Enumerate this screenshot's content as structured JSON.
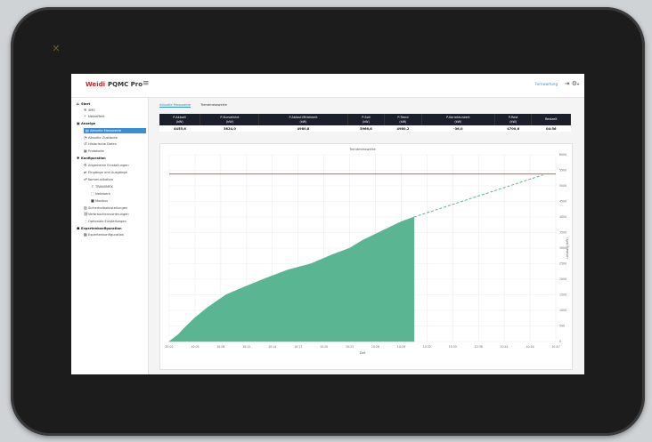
{
  "app": {
    "brand": "Weidi",
    "product": "PQMC Pro"
  },
  "topbar": {
    "user": "Fernwartung"
  },
  "sidebar": {
    "items": [
      {
        "label": "Start",
        "type": "head",
        "icon": "home-icon"
      },
      {
        "label": "SMS",
        "type": "sub",
        "icon": "sms-icon"
      },
      {
        "label": "Netzeffekt",
        "type": "sub",
        "icon": "network-icon"
      },
      {
        "label": "Anzeige",
        "type": "head",
        "icon": "display-icon"
      },
      {
        "label": "Aktuelle Messwerte",
        "type": "active",
        "icon": "chart-icon"
      },
      {
        "label": "Aktuelle Zustände",
        "type": "sub",
        "icon": "status-icon"
      },
      {
        "label": "Historische Daten",
        "type": "sub",
        "icon": "history-icon"
      },
      {
        "label": "Protokolle",
        "type": "sub",
        "icon": "log-icon"
      },
      {
        "label": "Konfiguration",
        "type": "head",
        "icon": "config-icon"
      },
      {
        "label": "Allgemeine Einstellungen",
        "type": "sub",
        "icon": "gear-icon"
      },
      {
        "label": "Eingänge und Ausgänge",
        "type": "sub",
        "icon": "io-icon"
      },
      {
        "label": "Kommunikation",
        "type": "sub",
        "icon": "comm-icon"
      },
      {
        "label": "TRANSMEX",
        "type": "sub2",
        "icon": "transmit-icon"
      },
      {
        "label": "Netzwerk",
        "type": "sub2",
        "icon": "lan-icon"
      },
      {
        "label": "Modbus",
        "type": "sub2",
        "icon": "modbus-icon"
      },
      {
        "label": "Sicherheitseinstellungen",
        "type": "sub",
        "icon": "lock-icon"
      },
      {
        "label": "Verbraucherzuordnungen",
        "type": "sub",
        "icon": "link-icon"
      },
      {
        "label": "Optionale Einstellungen",
        "type": "sub",
        "icon": "options-icon"
      },
      {
        "label": "Expertenkonfiguration",
        "type": "head",
        "icon": "expert-icon"
      },
      {
        "label": "Expertenkonfiguration",
        "type": "sub",
        "icon": "expert-sub-icon"
      }
    ]
  },
  "tabs": [
    {
      "label": "Aktuelle Messwerte",
      "active": true
    },
    {
      "label": "Trendmesswerte",
      "active": false
    }
  ],
  "kpi": {
    "headers": [
      "P-Aktuell\n(kW)",
      "P-Kurvefahrt\n(kW)",
      "P-Ablauf-Mittelwert\n(kW)",
      "P-Soll\n(kW)",
      "P-Trend\n(kW)",
      "P-Korrekturwert\n(kW)",
      "P-Rest\n(kW)",
      "Restzeit"
    ],
    "values": [
      "4455,6",
      "3624,0",
      "4980,8",
      "5966,6",
      "4980,2",
      "-36,0",
      "4700,6",
      "04:56"
    ]
  },
  "chart_data": {
    "type": "area",
    "title": "Trendmesswerte",
    "xlabel": "Zeit",
    "ylabel": "Leistung (kW)",
    "x_ticks": [
      "10:02",
      "10:05",
      "10:08",
      "10:11",
      "10:14",
      "10:17",
      "10:20",
      "10:23",
      "10:26",
      "10:29",
      "10:32",
      "10:35",
      "10:38",
      "10:41",
      "10:44",
      "10:47"
    ],
    "y_ticks": [
      0,
      500,
      1000,
      1500,
      2000,
      2500,
      3000,
      3500,
      4000,
      4500,
      5000,
      5500,
      6000
    ],
    "ylim": [
      0,
      6000
    ],
    "series": [
      {
        "kind": "area",
        "color": "#5ab592",
        "x": [
          0,
          0.35,
          0.55,
          0.95,
          1.5,
          2.2,
          3,
          3.8,
          4.6,
          5.5,
          6.3,
          7,
          7.5,
          8,
          8.5,
          9,
          9.5
        ],
        "y": [
          0,
          220,
          400,
          730,
          1100,
          1500,
          1780,
          2050,
          2300,
          2500,
          2780,
          3000,
          3250,
          3450,
          3650,
          3850,
          4000
        ]
      },
      {
        "kind": "dashed",
        "color": "#5ab592",
        "x": [
          9.5,
          14.5
        ],
        "y": [
          4000,
          5350
        ]
      },
      {
        "kind": "hline",
        "color": "#e0442c",
        "y": 5380
      }
    ],
    "grid": true,
    "colors": {
      "area": "#5ab592",
      "limit": "#e0442c"
    }
  }
}
